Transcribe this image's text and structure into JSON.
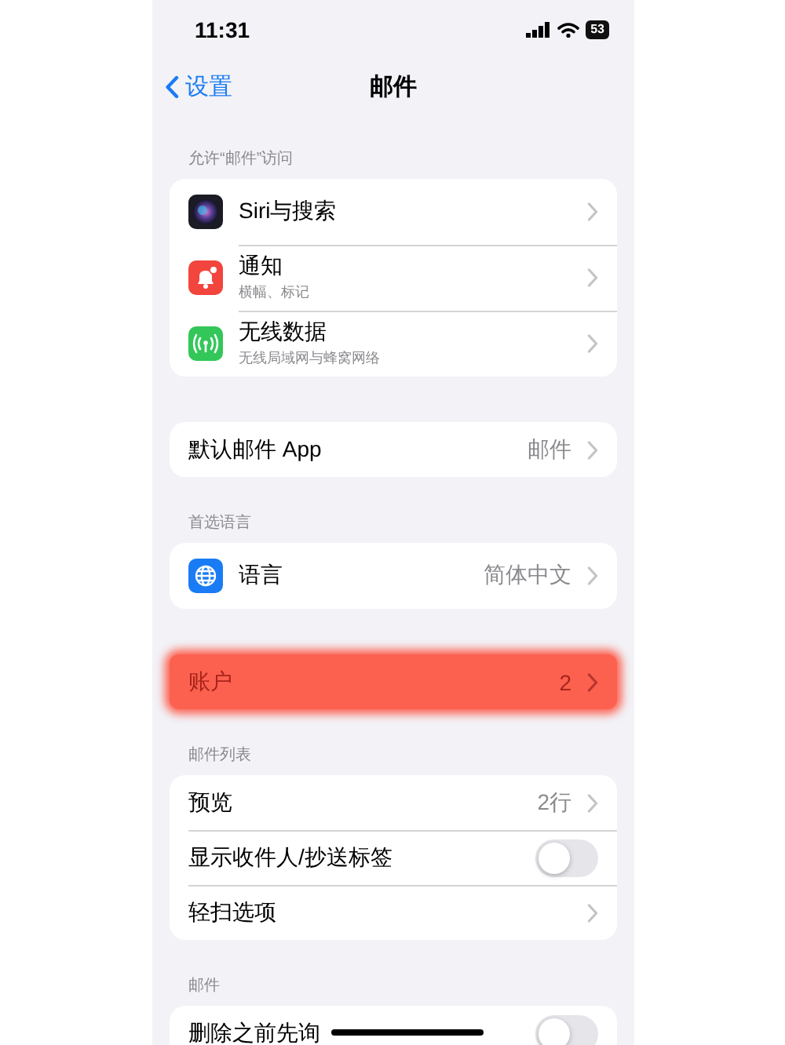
{
  "status_bar": {
    "time": "11:31",
    "battery": "53"
  },
  "nav": {
    "back": "设置",
    "title": "邮件"
  },
  "sections": [
    {
      "header": "允许“邮件”访问",
      "rows": [
        {
          "kind": "link",
          "label": "Siri与搜索"
        },
        {
          "kind": "link",
          "label": "通知",
          "subtitle": "横幅、标记"
        },
        {
          "kind": "link",
          "label": "无线数据",
          "subtitle": "无线局域网与蜂窝网络"
        }
      ]
    },
    {
      "rows": [
        {
          "kind": "link",
          "label": "默认邮件 App",
          "value": "邮件"
        }
      ]
    },
    {
      "header": "首选语言",
      "rows": [
        {
          "kind": "link",
          "label": "语言",
          "value": "简体中文"
        }
      ]
    },
    {
      "rows": [
        {
          "kind": "link",
          "label": "账户",
          "value": "2",
          "highlighted": true
        }
      ]
    },
    {
      "header": "邮件列表",
      "rows": [
        {
          "kind": "link",
          "label": "预览",
          "value": "2行"
        },
        {
          "kind": "toggle",
          "label": "显示收件人/抄送标签",
          "checked": false
        },
        {
          "kind": "link",
          "label": "轻扫选项"
        }
      ]
    },
    {
      "header": "邮件",
      "rows": [
        {
          "kind": "toggle",
          "label": "删除之前先询",
          "checked": false
        }
      ]
    }
  ]
}
